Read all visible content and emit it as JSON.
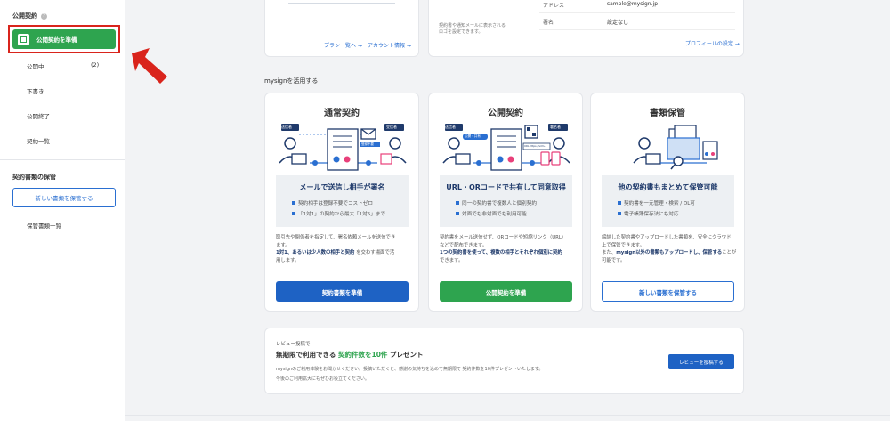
{
  "sidebar": {
    "public_heading": "公開契約",
    "help_icon": "?",
    "primary_label": "公開契約を準備",
    "items": [
      {
        "label": "公開中",
        "count": "(2)"
      },
      {
        "label": "下書き"
      },
      {
        "label": "公開終了"
      },
      {
        "label": "契約一覧"
      }
    ],
    "storage_heading": "契約書類の保管",
    "save_button": "新しい書類を保管する",
    "storage_list": "保管書類一覧"
  },
  "top": {
    "plan_link": "プラン一覧へ →",
    "account_link": "アカウント情報 →",
    "logo_note_line1": "契約書や通知メールに表示される",
    "logo_note_line2": "ロゴを設定できます。",
    "address_label": "アドレス",
    "address_value": "sample@mysign.jp",
    "signature_label": "署名",
    "signature_value": "設定なし",
    "profile_link": "プロフィールの設定 →"
  },
  "section_title": "mysignを活用する",
  "features": [
    {
      "title": "通常契約",
      "illus": {
        "left_tag": "送信者",
        "right_tag": "受信者",
        "mid_tag": "登録不要"
      },
      "headline": "メールで送信し相手が署名",
      "bullets": [
        "契約相手は登録不要でコストゼロ",
        "「1対1」の契約から最大「1対5」まで"
      ],
      "desc1": "取引先や関係者を指定して、署名依頼メールを送信でき",
      "desc2": "ます。",
      "desc3_b": "1対1、あるいは少人数の相手と契約",
      "desc3": "を交わす場面で活",
      "desc4": "用します。",
      "button": "契約書類を準備"
    },
    {
      "title": "公開契約",
      "illus": {
        "left_tag": "送信者",
        "right_tag": "署名者",
        "mid_tag": "公開・共有",
        "url_tag": "URL https://sdm..."
      },
      "headline": "URL・QRコードで共有して同意取得",
      "bullets": [
        "同一の契約書で複数人と個別契約",
        "対面でも非対面でも利用可能"
      ],
      "desc1": "契約書をメール送信せず、QRコードや短縮リンク（URL）",
      "desc2": "などで配布できます。",
      "desc3_b": "1つの契約書を使って、複数の相手とそれぞれ個別に契約",
      "desc4": "できます。",
      "button": "公開契約を準備"
    },
    {
      "title": "書類保管",
      "headline": "他の契約書もまとめて保管可能",
      "bullets": [
        "契約書を一元管理・検索 / DL可",
        "電子帳簿保存法にも対応"
      ],
      "desc1": "締結した契約書やアップロードした書類を、安全にクラウド",
      "desc2": "上で保管できます。",
      "desc3": "また、",
      "desc3_b": "mysign以外の書類もアップロードし、保管する",
      "desc3_tail": "ことが",
      "desc4": "可能です。",
      "button": "新しい書類を保管する"
    }
  ],
  "review": {
    "small": "レビュー投稿で",
    "main_prefix": "無期限で利用できる",
    "main_highlight": "契約件数を10件",
    "main_suffix": "プレゼント",
    "note1": "mysignのご利用体験をお聞かせください。投稿いただくと、感謝の気持ちを込めて無期限で 契約件数を10件プレゼントいたします。",
    "note2": "今後のご利用拡大にもぜひお役立てください。",
    "button": "レビューを投稿する"
  },
  "colors": {
    "green": "#2ea44f",
    "blue": "#1e62c4",
    "accent_red": "#d9241c",
    "navy": "#1f3a6b"
  }
}
